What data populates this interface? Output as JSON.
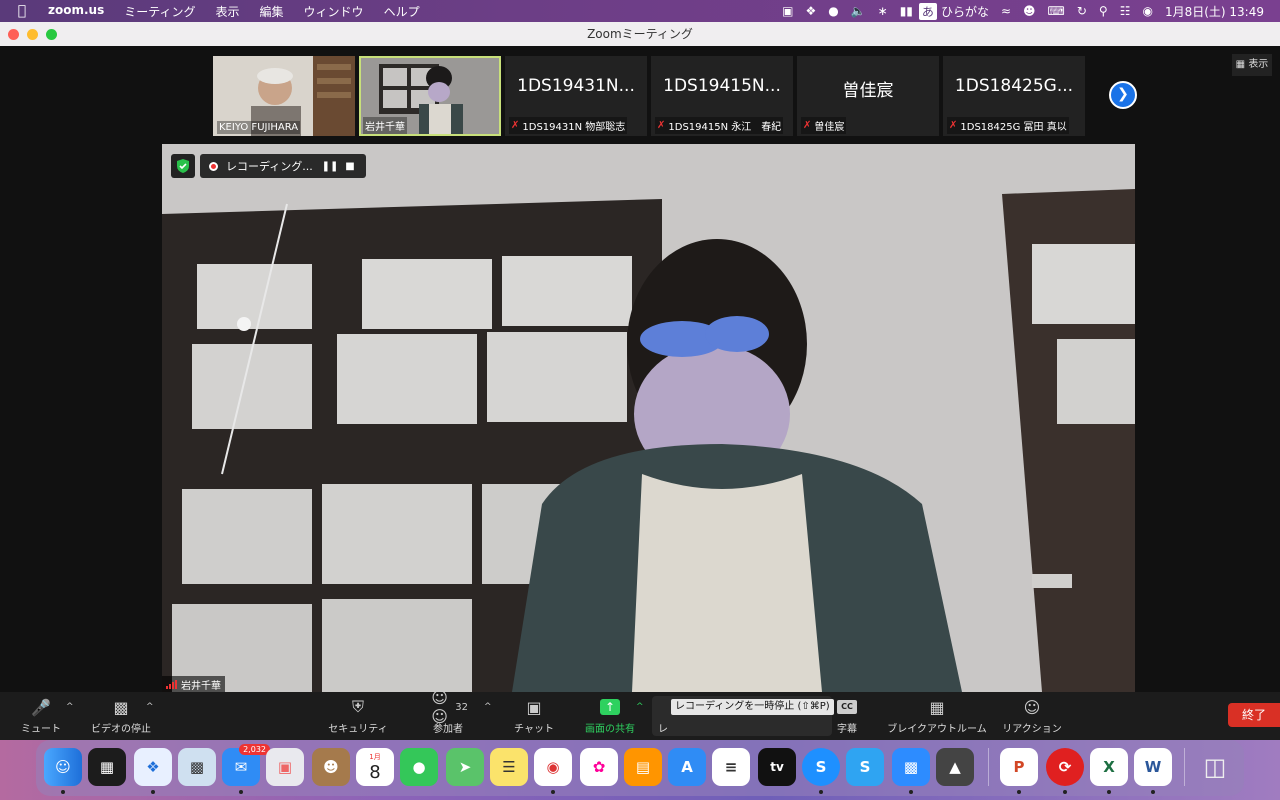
{
  "menubar": {
    "app_name": "zoom.us",
    "menus": [
      "ミーティング",
      "表示",
      "編集",
      "ウィンドウ",
      "ヘルプ"
    ],
    "input_mode": "あ",
    "input_label": "ひらがな",
    "datetime": "1月8日(土)  13:49"
  },
  "window": {
    "title": "Zoomミーティング",
    "view_label": "表示"
  },
  "thumbnails": [
    {
      "caption": "KEIYO FUJIHARA",
      "big": "",
      "video": true
    },
    {
      "caption": "岩井千華",
      "big": "",
      "video": true,
      "selected": true
    },
    {
      "caption": "1DS19431N 物部聡志",
      "big": "1DS19431N...",
      "video": false
    },
    {
      "caption": "1DS19415N 永江　春紀",
      "big": "1DS19415N...",
      "video": false
    },
    {
      "caption": "曽佳宸",
      "big": "曽佳宸",
      "video": false
    },
    {
      "caption": "1DS18425G 冨田 真以",
      "big": "1DS18425G...",
      "video": false
    }
  ],
  "recording": {
    "label": "レコーディング..."
  },
  "main_video": {
    "speaker_name": "岩井千華"
  },
  "toolbar": {
    "mute": "ミュート",
    "video_stop": "ビデオの停止",
    "security": "セキュリティ",
    "participants": "参加者",
    "participants_count": "32",
    "chat": "チャット",
    "share_screen": "画面の共有",
    "record_partial": "レ",
    "captions": "字幕",
    "captions_icon": "CC",
    "breakout": "ブレイクアウトルーム",
    "reactions": "リアクション",
    "end": "終了",
    "tooltip": "レコーディングを一時停止 (⇧⌘P)"
  },
  "dock": {
    "calendar_month": "1月",
    "calendar_day": "8",
    "mail_badge": "2,032",
    "tv_label": "tv"
  }
}
